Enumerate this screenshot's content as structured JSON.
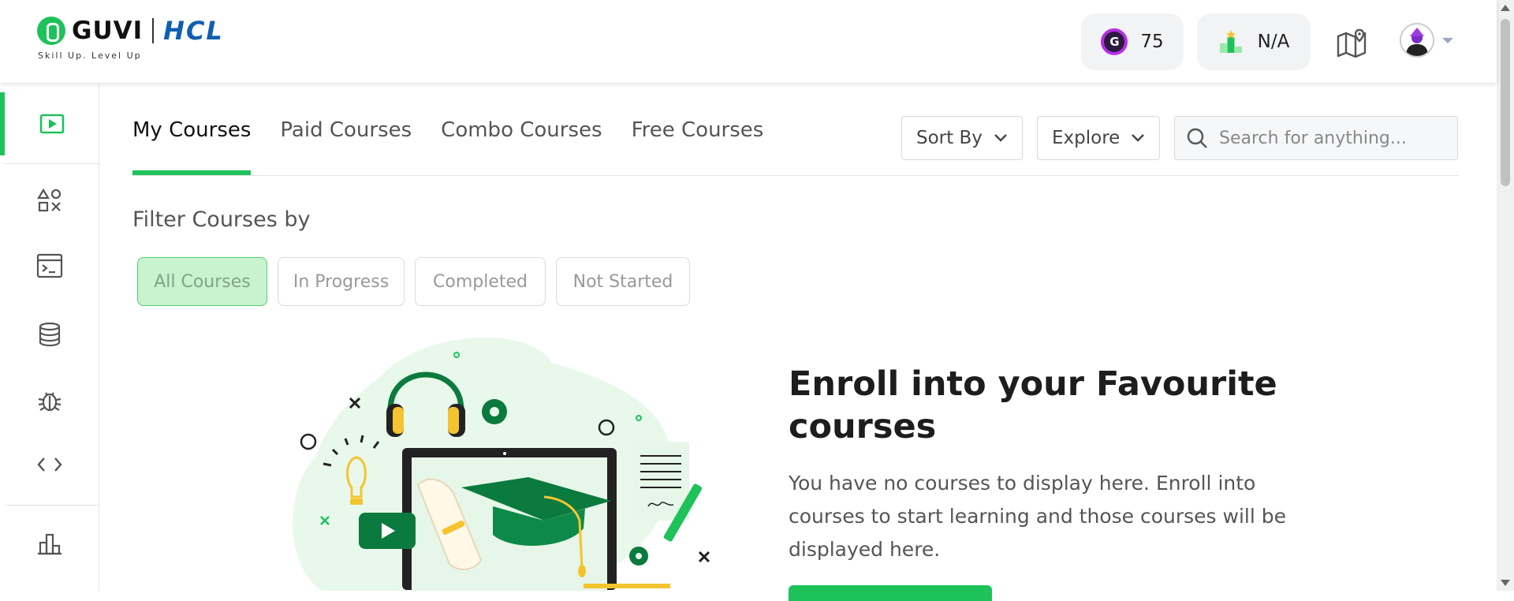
{
  "header": {
    "logo": {
      "brand": "GUVI",
      "partner": "HCL",
      "tagline": "Skill Up. Level Up"
    },
    "coins": {
      "value": "75",
      "icon": "geekoin-icon",
      "icon_letter": "G"
    },
    "rank": {
      "value": "N/A",
      "icon": "leaderboard-podium-icon"
    },
    "map_icon": "learning-path-map-icon",
    "avatar_icon": "user-avatar-icon"
  },
  "sidebar": {
    "items": [
      {
        "name": "courses",
        "icon": "play-video-icon",
        "active": true
      },
      {
        "name": "practice",
        "icon": "shapes-icon",
        "active": false
      },
      {
        "name": "ide",
        "icon": "terminal-window-icon",
        "active": false
      },
      {
        "name": "database",
        "icon": "database-icon",
        "active": false
      },
      {
        "name": "debug",
        "icon": "bug-icon",
        "active": false
      },
      {
        "name": "code",
        "icon": "code-brackets-icon",
        "active": false
      },
      {
        "name": "stats",
        "icon": "bar-chart-icon",
        "active": false
      }
    ]
  },
  "tabs": [
    {
      "label": "My Courses",
      "active": true
    },
    {
      "label": "Paid Courses",
      "active": false
    },
    {
      "label": "Combo Courses",
      "active": false
    },
    {
      "label": "Free Courses",
      "active": false
    }
  ],
  "controls": {
    "sort_label": "Sort By",
    "explore_label": "Explore",
    "search_placeholder": "Search for anything..."
  },
  "filter": {
    "title": "Filter Courses by",
    "chips": [
      {
        "label": "All Courses",
        "active": true
      },
      {
        "label": "In Progress",
        "active": false
      },
      {
        "label": "Completed",
        "active": false
      },
      {
        "label": "Not Started",
        "active": false
      }
    ]
  },
  "empty_state": {
    "title": "Enroll into your Favourite courses",
    "description": "You have no courses to display here. Enroll into courses to start learning and those courses will be displayed here."
  },
  "colors": {
    "brand_green": "#1DC25A",
    "hcl_blue": "#0F5FAF",
    "chip_active_bg": "#C9F2CF",
    "coin_purple": "#B52FE6"
  }
}
